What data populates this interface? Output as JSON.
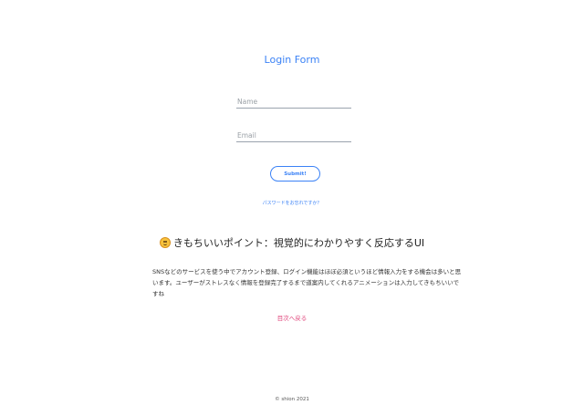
{
  "form": {
    "title": "Login Form",
    "name_placeholder": "Name",
    "email_placeholder": "Email",
    "submit_label": "Submit!",
    "forgot_link": "パスワードをお忘れですか？"
  },
  "section": {
    "heading": "きもちいいポイント：視覚的にわかりやすく反応するUI",
    "emoji_icon": "smiling-face-icon",
    "description": "SNSなどのサービスを使う中でアカウント登録、ログイン機能はほぼ必須というほど情報入力をする機会は多いと思います。ユーザーがストレスなく情報を登録完了するまで道案内してくれるアニメーションは入力してきもちいいですね",
    "back_link": "目次へ戻る"
  },
  "footer": {
    "copyright": "© shion 2021"
  },
  "colors": {
    "accent": "#3b82f6",
    "link_pink": "#e0457b"
  }
}
